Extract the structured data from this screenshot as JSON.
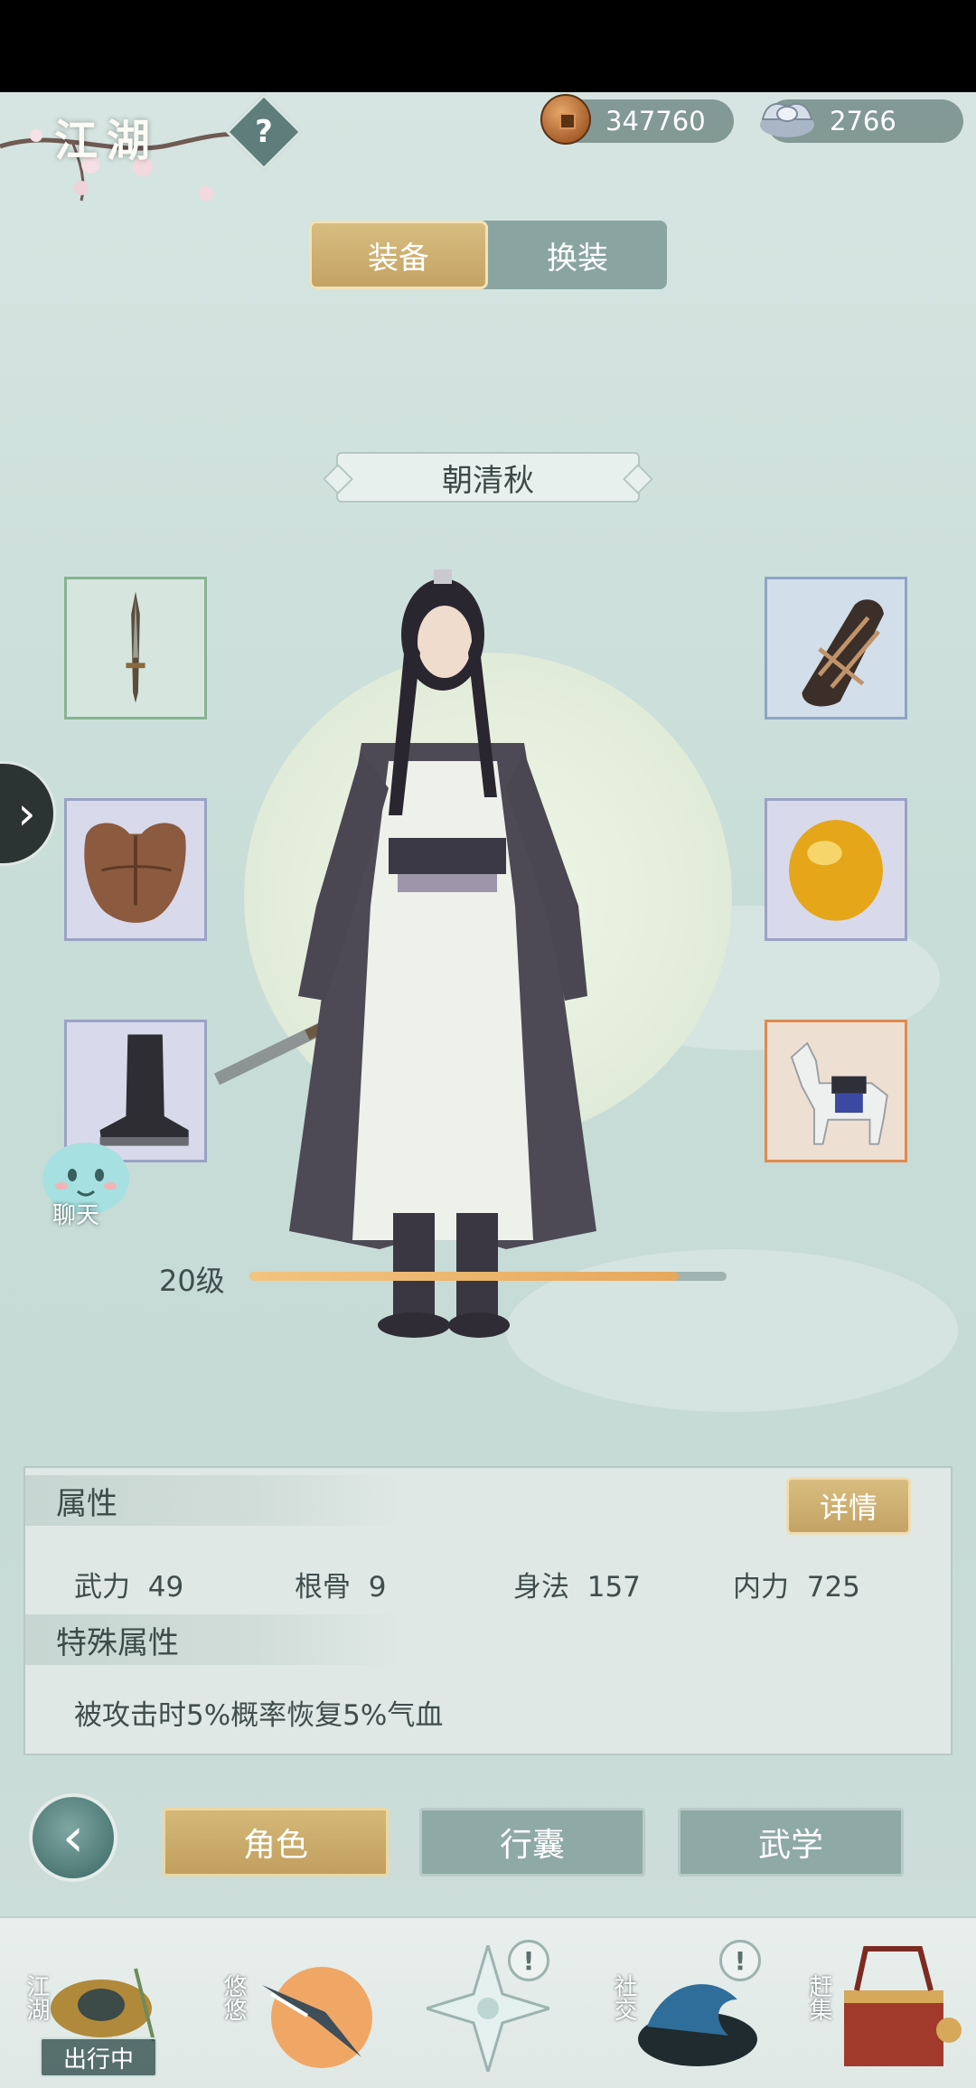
{
  "header": {
    "title": "江湖",
    "help_icon": "question-icon",
    "copper": "347760",
    "silver": "2766"
  },
  "top_tabs": {
    "equip": "装备",
    "change_outfit": "换装"
  },
  "character": {
    "name": "朝清秋",
    "level_label": "20级",
    "level_progress": 0.9
  },
  "slots": {
    "weapon": "sword-icon",
    "bracer": "bracer-icon",
    "armor": "armor-icon",
    "amulet": "amber-icon",
    "boots": "boot-icon",
    "mount": "horse-icon"
  },
  "chat": {
    "label": "聊天"
  },
  "attributes": {
    "title": "属性",
    "detail_button": "详情",
    "stats": [
      {
        "label": "武力",
        "value": "49"
      },
      {
        "label": "根骨",
        "value": "9"
      },
      {
        "label": "身法",
        "value": "157"
      },
      {
        "label": "内力",
        "value": "725"
      }
    ],
    "special_title": "特殊属性",
    "special_text": "被攻击时5%概率恢复5%气血"
  },
  "nav_tabs": {
    "role": "角色",
    "bag": "行囊",
    "martial": "武学"
  },
  "dock": {
    "jianghu": "江湖",
    "travel_status": "出行中",
    "youyou": "悠悠",
    "social": "社交",
    "market": "赶集",
    "badge": "!"
  },
  "colors": {
    "gold_accent": "#c4a365",
    "teal_bg": "#cfe0dc",
    "slot_orange": "#e2894d"
  }
}
